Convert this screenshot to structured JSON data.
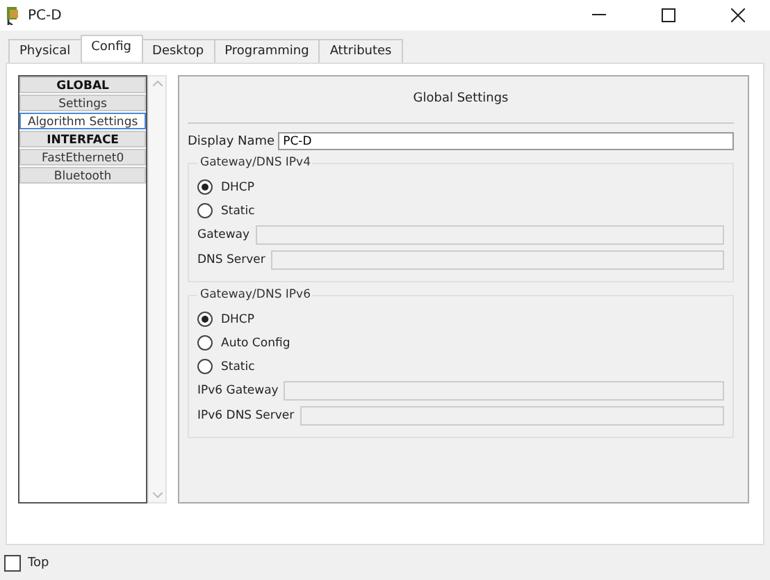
{
  "window": {
    "title": "PC-D"
  },
  "tabs": [
    {
      "label": "Physical",
      "selected": false
    },
    {
      "label": "Config",
      "selected": true
    },
    {
      "label": "Desktop",
      "selected": false
    },
    {
      "label": "Programming",
      "selected": false
    },
    {
      "label": "Attributes",
      "selected": false
    }
  ],
  "sidebar": {
    "items": [
      {
        "kind": "header",
        "label": "GLOBAL",
        "selected": false
      },
      {
        "kind": "item",
        "label": "Settings",
        "selected": false
      },
      {
        "kind": "item",
        "label": "Algorithm Settings",
        "selected": true
      },
      {
        "kind": "header",
        "label": "INTERFACE",
        "selected": false
      },
      {
        "kind": "item",
        "label": "FastEthernet0",
        "selected": false
      },
      {
        "kind": "item",
        "label": "Bluetooth",
        "selected": false
      }
    ]
  },
  "panel": {
    "title": "Global Settings",
    "display_name": {
      "label": "Display Name",
      "value": "PC-D"
    },
    "groups": [
      {
        "title": "Gateway/DNS IPv4",
        "options": [
          {
            "label": "DHCP",
            "selected": true
          },
          {
            "label": "Static",
            "selected": false
          }
        ],
        "fields": [
          {
            "label": "Gateway",
            "disabled": true
          },
          {
            "label": "DNS Server",
            "disabled": true
          }
        ]
      },
      {
        "title": "Gateway/DNS IPv6",
        "options": [
          {
            "label": "DHCP",
            "selected": true
          },
          {
            "label": "Auto Config",
            "selected": false
          },
          {
            "label": "Static",
            "selected": false
          }
        ],
        "fields": [
          {
            "label": "IPv6 Gateway",
            "disabled": true
          },
          {
            "label": "IPv6 DNS Server",
            "disabled": true
          }
        ]
      }
    ]
  },
  "footer": {
    "top": {
      "label": "Top",
      "checked": false
    }
  }
}
